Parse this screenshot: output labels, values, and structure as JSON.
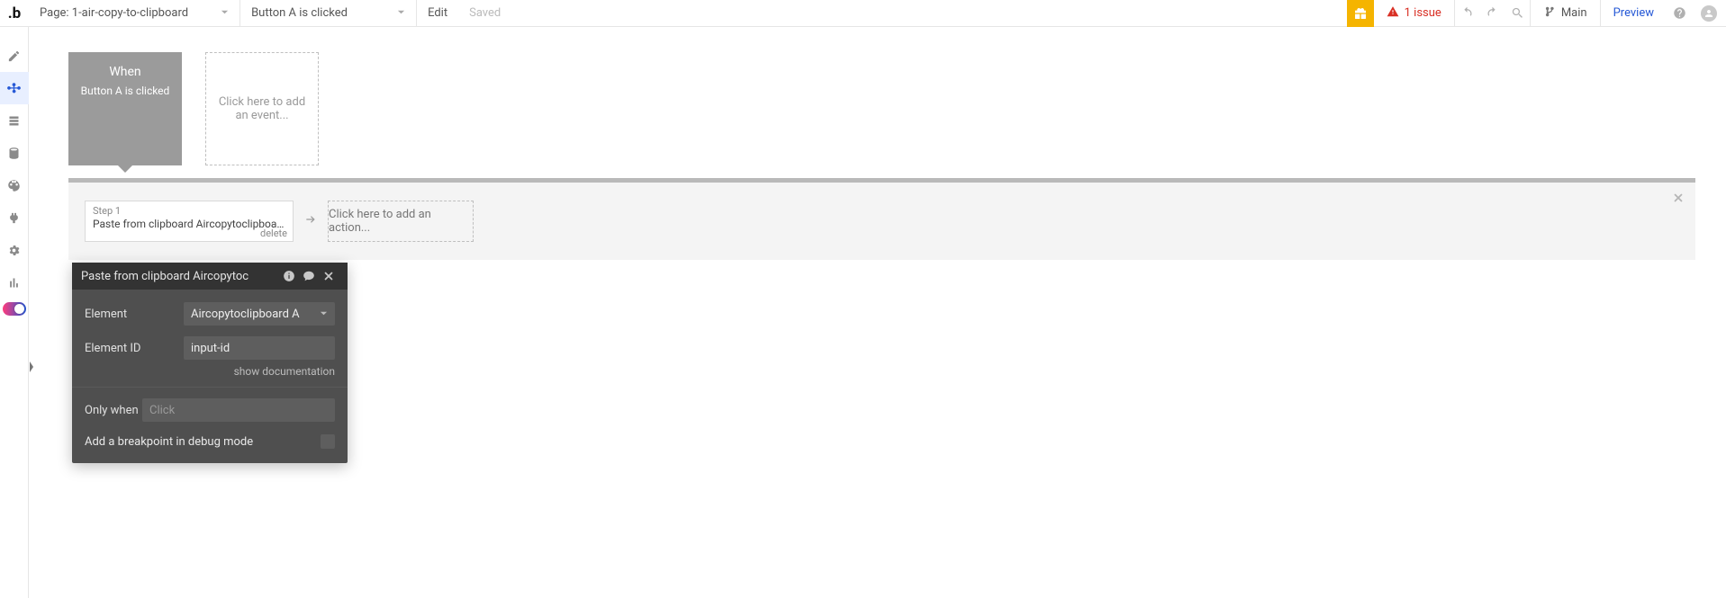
{
  "topbar": {
    "page_prefix": "Page: ",
    "page_name": "1-air-copy-to-clipboard",
    "workflow_name": "Button A is clicked",
    "edit": "Edit",
    "saved": "Saved",
    "issue_count": "1 issue",
    "branch": "Main",
    "preview": "Preview"
  },
  "event": {
    "when": "When",
    "condition": "Button A is clicked",
    "add_event_placeholder": "Click here to add an event..."
  },
  "step": {
    "number": "Step 1",
    "title": "Paste from clipboard Aircopytoclipboard A",
    "delete": "delete",
    "add_action_placeholder": "Click here to add an action..."
  },
  "panel": {
    "title": "Paste from clipboard Aircopytoc",
    "labels": {
      "element": "Element",
      "element_id": "Element ID",
      "only_when": "Only when",
      "breakpoint": "Add a breakpoint in debug mode"
    },
    "element_value": "Aircopytoclipboard A",
    "element_id_value": "input-id",
    "only_when_placeholder": "Click",
    "doc_link": "show documentation"
  }
}
